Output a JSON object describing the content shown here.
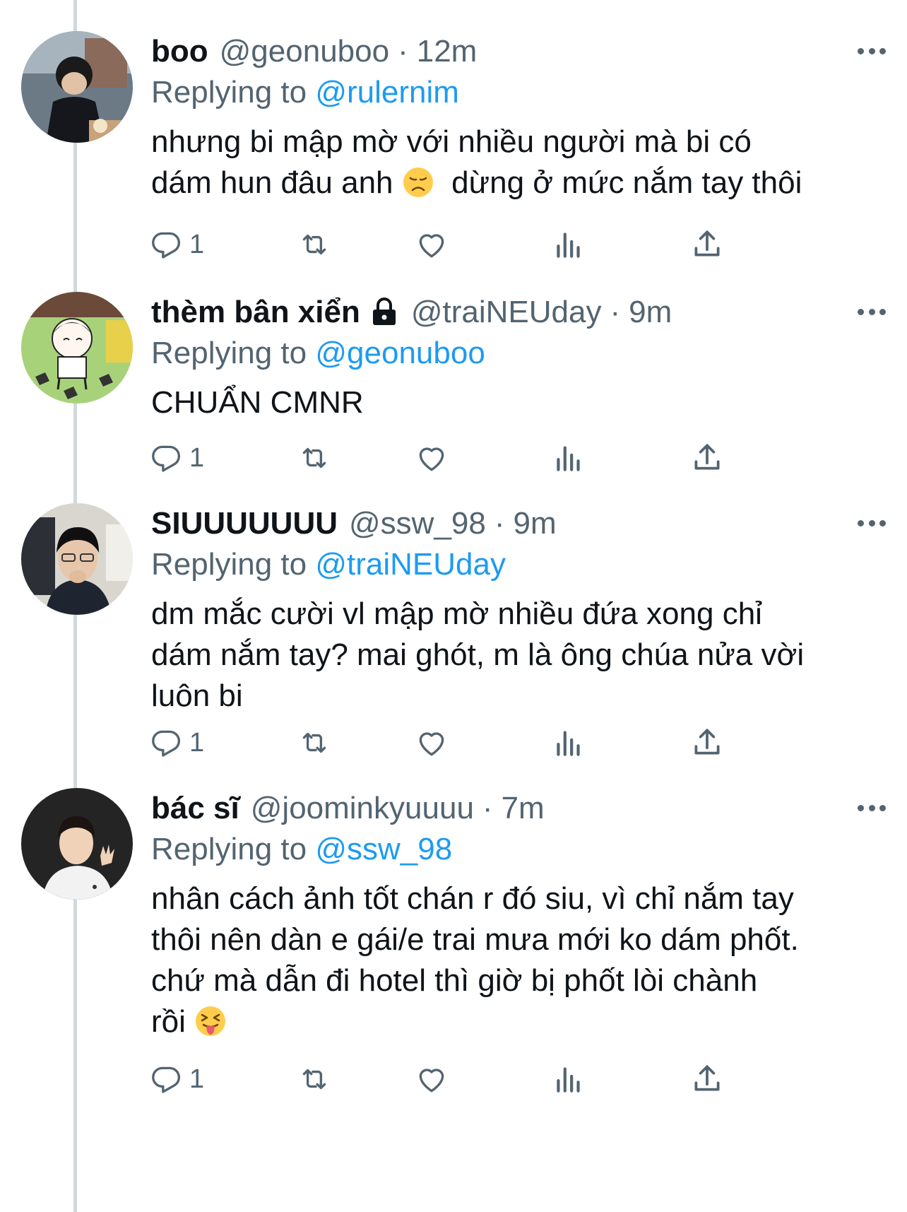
{
  "tweets": [
    {
      "name": "boo",
      "handle": "@geonuboo",
      "dot": "·",
      "time": "12m",
      "replying_prefix": "Replying to ",
      "replying_to": "@rulernim",
      "text_before_emoji": "nhưng bi mập mờ với nhiều người mà bi có\ndám hun đâu anh ",
      "emoji": "disappointed-face",
      "text_after_emoji": "  dừng ở mức nắm tay thôi",
      "reply_count": "1",
      "locked": false
    },
    {
      "name": "thèm bân xiển",
      "handle": "@traiNEUday",
      "dot": "·",
      "time": "9m",
      "replying_prefix": "Replying to ",
      "replying_to": "@geonuboo",
      "text_before_emoji": "CHUẨN CMNR",
      "emoji": "",
      "text_after_emoji": "",
      "reply_count": "1",
      "locked": true
    },
    {
      "name": "SIUUUUUUU",
      "handle": "@ssw_98",
      "dot": "·",
      "time": "9m",
      "replying_prefix": "Replying to ",
      "replying_to": "@traiNEUday",
      "text_before_emoji": "dm mắc cười vl mập mờ nhiều đứa xong chỉ\ndám nắm tay? mai ghót, m là ông chúa nửa vời\nluôn bi",
      "emoji": "",
      "text_after_emoji": "",
      "reply_count": "1",
      "locked": false
    },
    {
      "name": "bác sĩ",
      "handle": "@joominkyuuuu",
      "dot": "·",
      "time": "7m",
      "replying_prefix": "Replying to ",
      "replying_to": "@ssw_98",
      "text_before_emoji": "nhân cách ảnh tốt chán r đó siu, vì chỉ nắm tay\nthôi nên dàn e gái/e trai mưa mới ko dám phốt.\nchứ mà dẫn đi hotel thì giờ bị phốt lòi chành\nrồi ",
      "emoji": "squinting-tongue-face",
      "text_after_emoji": "",
      "reply_count": "1",
      "locked": false
    }
  ],
  "icons": {
    "reply": "reply-icon",
    "retweet": "retweet-icon",
    "like": "heart-icon",
    "views": "views-icon",
    "share": "share-icon",
    "more": "more-icon",
    "lock": "lock-icon"
  },
  "colors": {
    "text": "#0f1419",
    "secondary": "#536471",
    "mention": "#1d9bf0",
    "thread_line": "#cfd9de",
    "emoji_yellow": "#ffcc4d"
  }
}
